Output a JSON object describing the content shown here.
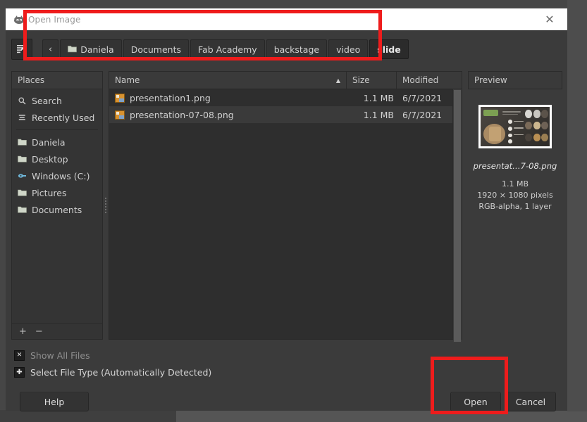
{
  "window": {
    "title": "Open Image",
    "app_icon": "gimp-wilber-icon",
    "close_label": "✕"
  },
  "pathbar": {
    "toggle_icon": "type-filename-icon",
    "back_label": "‹",
    "folder_icon": "folder-icon",
    "crumbs": [
      {
        "label": "Daniela",
        "active": false,
        "has_folder_icon": true
      },
      {
        "label": "Documents",
        "active": false,
        "has_folder_icon": false
      },
      {
        "label": "Fab Academy",
        "active": false,
        "has_folder_icon": false
      },
      {
        "label": "backstage",
        "active": false,
        "has_folder_icon": false
      },
      {
        "label": "video",
        "active": false,
        "has_folder_icon": false
      },
      {
        "label": "slide",
        "active": true,
        "has_folder_icon": false
      }
    ]
  },
  "places": {
    "header": "Places",
    "items": [
      {
        "label": "Search",
        "icon": "search-icon",
        "glyph": "⌕"
      },
      {
        "label": "Recently Used",
        "icon": "recent-icon",
        "glyph": "☰"
      },
      {
        "label": "Daniela",
        "icon": "folder-icon",
        "glyph": "▬"
      },
      {
        "label": "Desktop",
        "icon": "folder-icon",
        "glyph": "▬"
      },
      {
        "label": "Windows (C:)",
        "icon": "drive-icon",
        "glyph": "⬤"
      },
      {
        "label": "Pictures",
        "icon": "folder-icon",
        "glyph": "▬"
      },
      {
        "label": "Documents",
        "icon": "folder-icon",
        "glyph": "▬"
      }
    ],
    "add_label": "+",
    "remove_label": "−"
  },
  "filelist": {
    "columns": {
      "name": "Name",
      "size": "Size",
      "modified": "Modified"
    },
    "sort_caret": "▲",
    "rows": [
      {
        "name": "presentation1.png",
        "size": "1.1 MB",
        "modified": "6/7/2021",
        "selected": false
      },
      {
        "name": "presentation-07-08.png",
        "size": "1.1 MB",
        "modified": "6/7/2021",
        "selected": true
      }
    ]
  },
  "preview": {
    "header": "Preview",
    "filename": "presentat…7-08.png",
    "size": "1.1 MB",
    "dimensions": "1920 × 1080 pixels",
    "color_info": "RGB-alpha, 1 layer"
  },
  "options": {
    "show_all_files": {
      "label": "Show All Files",
      "checked": true,
      "mark": "✕"
    },
    "select_file_type": {
      "label": "Select File Type (Automatically Detected)",
      "expanded": false,
      "mark": "✚"
    }
  },
  "buttons": {
    "help": "Help",
    "open": "Open",
    "cancel": "Cancel"
  },
  "annotations": {
    "accent_color": "#ee1c1c",
    "boxes": [
      {
        "name": "path-bar-highlight"
      },
      {
        "name": "open-button-highlight"
      }
    ]
  }
}
